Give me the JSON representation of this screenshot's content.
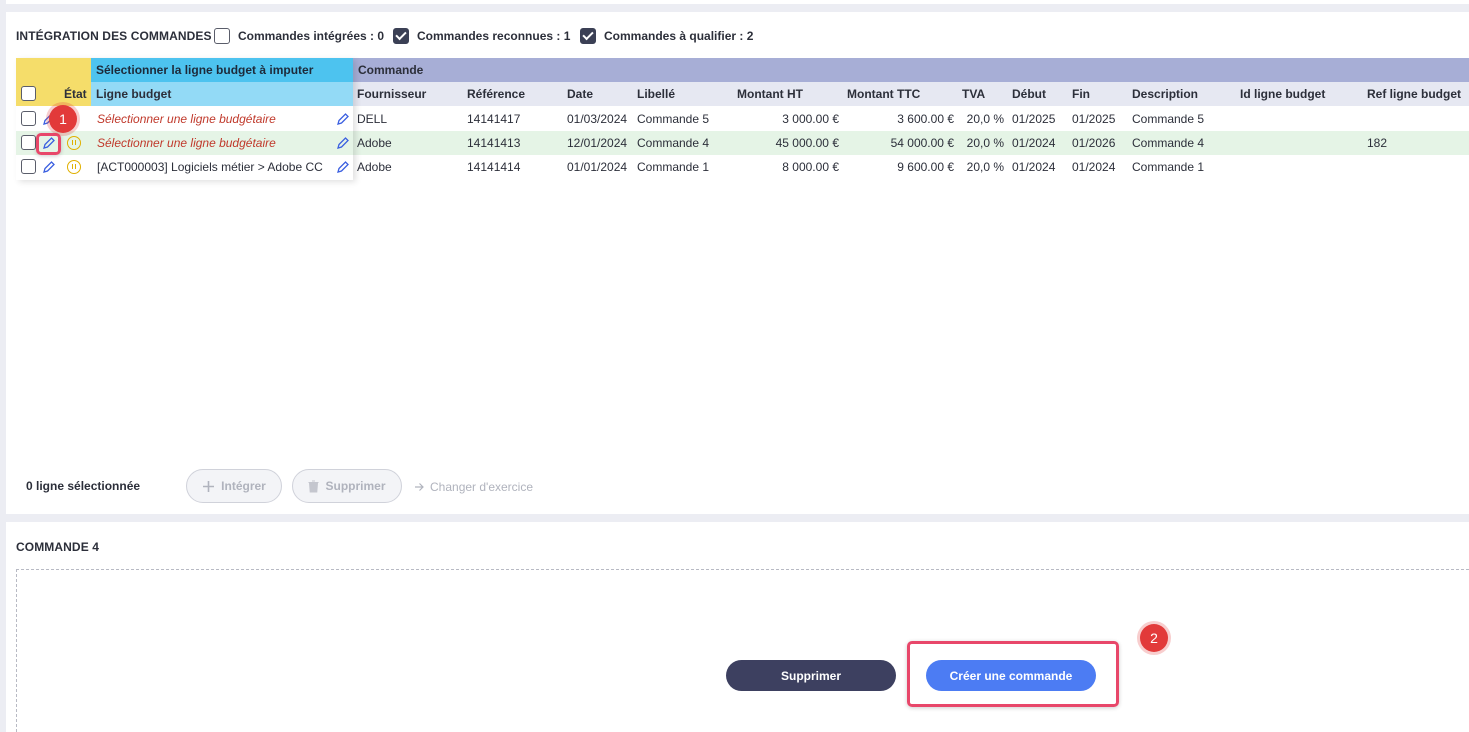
{
  "top": {
    "title": "INTÉGRATION DES COMMANDES",
    "filters": [
      {
        "label": "Commandes intégrées : 0",
        "checked": false
      },
      {
        "label": "Commandes reconnues : 1",
        "checked": true
      },
      {
        "label": "Commandes à qualifier : 2",
        "checked": true
      }
    ]
  },
  "table": {
    "group_select": "Sélectionner la ligne budget à imputer",
    "group_commande": "Commande",
    "col_etat": "État",
    "col_ligne_budget": "Ligne budget",
    "columns": [
      "Fournisseur",
      "Référence",
      "Date",
      "Libellé",
      "Montant HT",
      "Montant TTC",
      "TVA",
      "Début",
      "Fin",
      "Description",
      "Id ligne budget",
      "Ref ligne budget"
    ],
    "rows": [
      {
        "ligne": "Sélectionner une ligne budgétaire",
        "placeholder": true,
        "fournisseur": "DELL",
        "reference": "14141417",
        "date": "01/03/2024",
        "libelle": "Commande 5",
        "ht": "3 000.00 €",
        "ttc": "3 600.00 €",
        "tva": "20,0 %",
        "debut": "01/2025",
        "fin": "01/2025",
        "description": "Commande 5",
        "id_ligne": "",
        "ref_ligne": ""
      },
      {
        "ligne": "Sélectionner une ligne budgétaire",
        "placeholder": true,
        "fournisseur": "Adobe",
        "reference": "14141413",
        "date": "12/01/2024",
        "libelle": "Commande 4",
        "ht": "45 000.00 €",
        "ttc": "54 000.00 €",
        "tva": "20,0 %",
        "debut": "01/2024",
        "fin": "01/2026",
        "description": "Commande 4",
        "id_ligne": "",
        "ref_ligne": "182"
      },
      {
        "ligne": "[ACT000003] Logiciels métier > Adobe CC",
        "placeholder": false,
        "fournisseur": "Adobe",
        "reference": "14141414",
        "date": "01/01/2024",
        "libelle": "Commande 1",
        "ht": "8 000.00 €",
        "ttc": "9 600.00 €",
        "tva": "20,0 %",
        "debut": "01/2024",
        "fin": "01/2024",
        "description": "Commande 1",
        "id_ligne": "",
        "ref_ligne": ""
      }
    ]
  },
  "footer": {
    "selected_count": "0 ligne sélectionnée",
    "integrate": "Intégrer",
    "delete": "Supprimer",
    "change_year": "Changer d'exercice"
  },
  "bottom": {
    "title": "COMMANDE 4",
    "delete_button": "Supprimer",
    "create_button": "Créer une commande"
  },
  "annotations": {
    "badge1": "1",
    "badge2": "2"
  },
  "colors": {
    "select_header": "#4dc3ef",
    "ligne_header": "#93daf6",
    "commande_header": "#a7aed6",
    "sub_header": "#e6e8f2",
    "etat_header": "#f5dd6a",
    "highlight_row": "#e5f4e6",
    "accent_blue": "#4c7cf3",
    "dark_button": "#3d4060",
    "badge_red": "#e23a3a"
  }
}
